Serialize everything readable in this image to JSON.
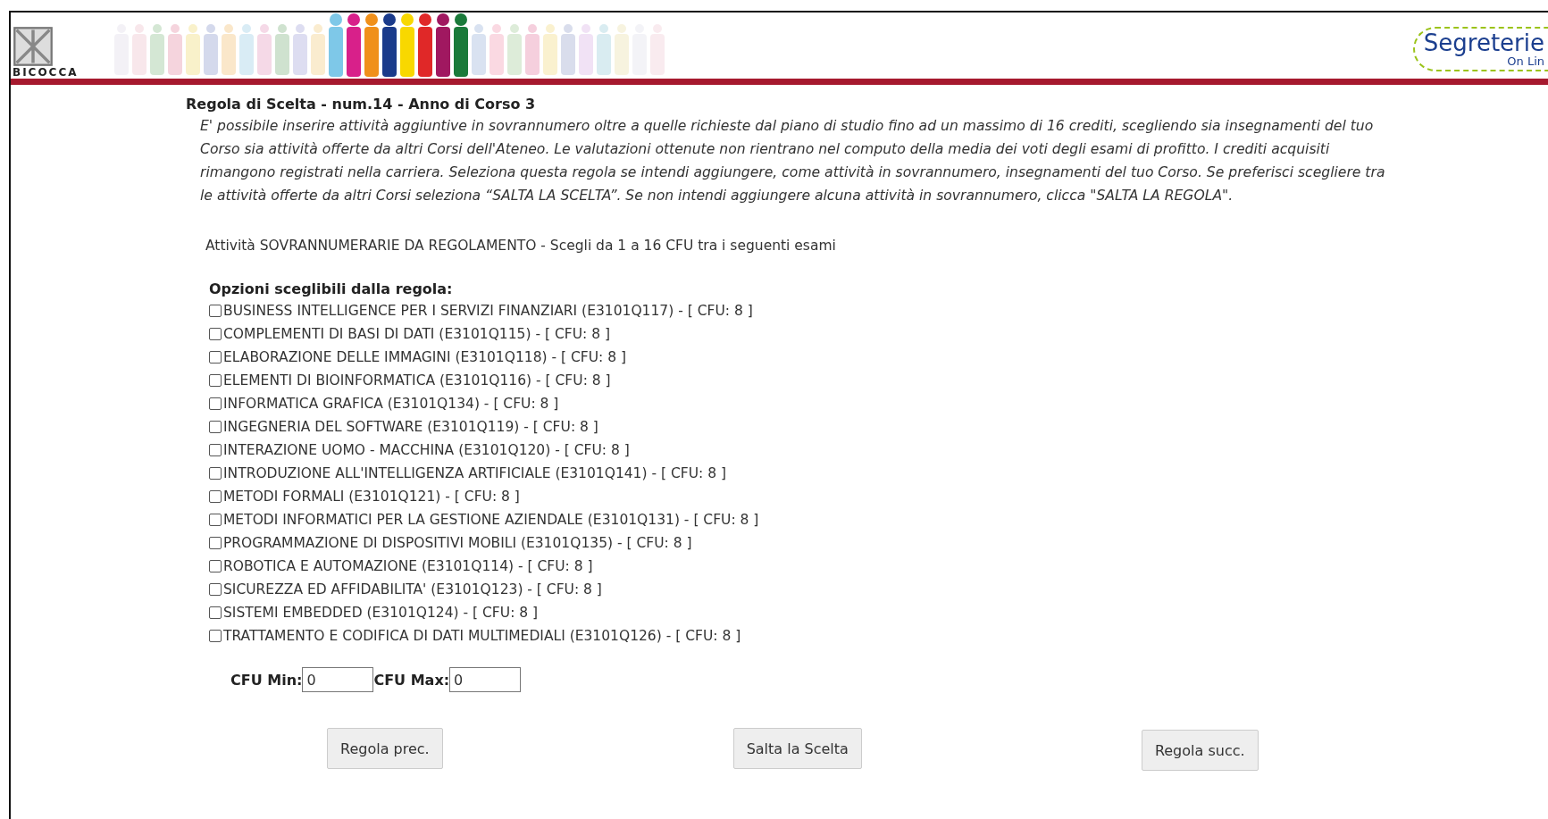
{
  "header": {
    "university_logo": {
      "text": "BICOCCA"
    },
    "service_logo": {
      "text": "Segreterie",
      "subtext": "On Lin"
    }
  },
  "rule": {
    "title": "Regola di Scelta - num.14 - Anno di Corso 3",
    "description": "E' possibile inserire attività aggiuntive in sovrannumero oltre a quelle richieste dal piano di studio fino ad un massimo di 16 crediti, scegliendo sia insegnamenti del tuo Corso sia attività offerte da altri Corsi dell'Ateneo. Le valutazioni ottenute non rientrano nel computo della media dei voti degli esami di profitto. I crediti acquisiti rimangono registrati nella carriera. Seleziona questa regola se intendi aggiungere, come attività in sovrannumero, insegnamenti del tuo Corso. Se preferisci scegliere tra le attività offerte da altri Corsi seleziona “SALTA LA SCELTA”. Se non intendi aggiungere alcuna attività in sovrannumero, clicca \"SALTA LA REGOLA\".",
    "instruction": "Attività SOVRANNUMERARIE DA REGOLAMENTO - Scegli da 1 a 16 CFU tra i seguenti esami",
    "options_heading": "Opzioni sceglibili dalla regola:",
    "options": [
      {
        "label": "BUSINESS INTELLIGENCE PER I SERVIZI FINANZIARI (E3101Q117) - [ CFU: 8 ]",
        "checked": false
      },
      {
        "label": "COMPLEMENTI DI BASI DI DATI (E3101Q115) - [ CFU: 8 ]",
        "checked": false
      },
      {
        "label": "ELABORAZIONE DELLE IMMAGINI (E3101Q118) - [ CFU: 8 ]",
        "checked": false
      },
      {
        "label": "ELEMENTI DI BIOINFORMATICA (E3101Q116) - [ CFU: 8 ]",
        "checked": false
      },
      {
        "label": "INFORMATICA GRAFICA (E3101Q134) - [ CFU: 8 ]",
        "checked": false
      },
      {
        "label": "INGEGNERIA DEL SOFTWARE (E3101Q119) - [ CFU: 8 ]",
        "checked": false
      },
      {
        "label": "INTERAZIONE UOMO - MACCHINA (E3101Q120) - [ CFU: 8 ]",
        "checked": false
      },
      {
        "label": "INTRODUZIONE ALL'INTELLIGENZA ARTIFICIALE (E3101Q141) - [ CFU: 8 ]",
        "checked": false
      },
      {
        "label": "METODI FORMALI (E3101Q121) - [ CFU: 8 ]",
        "checked": false
      },
      {
        "label": "METODI INFORMATICI PER LA GESTIONE AZIENDALE (E3101Q131) - [ CFU: 8 ]",
        "checked": false
      },
      {
        "label": "PROGRAMMAZIONE DI DISPOSITIVI MOBILI (E3101Q135) - [ CFU: 8 ]",
        "checked": false
      },
      {
        "label": "ROBOTICA E AUTOMAZIONE (E3101Q114) - [ CFU: 8 ]",
        "checked": false
      },
      {
        "label": "SICUREZZA ED AFFIDABILITA' (E3101Q123) - [ CFU: 8 ]",
        "checked": false
      },
      {
        "label": "SISTEMI EMBEDDED (E3101Q124) - [ CFU: 8 ]",
        "checked": false
      },
      {
        "label": "TRATTAMENTO E CODIFICA DI DATI MULTIMEDIALI (E3101Q126) - [ CFU: 8 ]",
        "checked": false
      }
    ],
    "cfu_fields": [
      {
        "label": "CFU Min:",
        "value": "0"
      },
      {
        "label": "CFU Max:",
        "value": "0"
      }
    ]
  },
  "buttons": [
    "Regola prec.",
    "Salta la Scelta",
    "Regola succ."
  ]
}
